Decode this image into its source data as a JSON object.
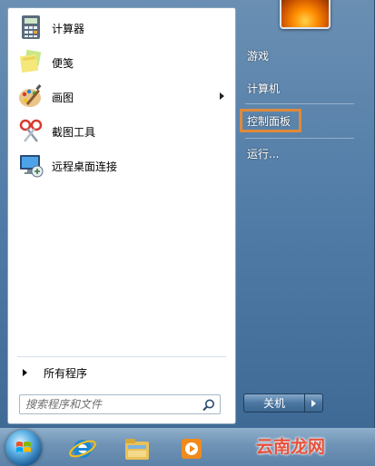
{
  "left_pane": {
    "items": [
      {
        "label": "计算器",
        "icon": "calculator-icon"
      },
      {
        "label": "便笺",
        "icon": "sticky-notes-icon"
      },
      {
        "label": "画图",
        "icon": "paint-icon",
        "has_submenu": true
      },
      {
        "label": "截图工具",
        "icon": "snipping-tool-icon"
      },
      {
        "label": "远程桌面连接",
        "icon": "remote-desktop-icon"
      }
    ],
    "all_programs": "所有程序",
    "search_placeholder": "搜索程序和文件"
  },
  "right_pane": {
    "items": [
      {
        "label": "游戏"
      },
      {
        "label": "计算机"
      },
      {
        "label": "控制面板",
        "highlighted": true,
        "highlight_color": "#e08a3a"
      },
      {
        "label": "运行..."
      }
    ],
    "shutdown_label": "关机"
  },
  "taskbar": {
    "icons": [
      "start-orb-icon",
      "internet-explorer-icon",
      "windows-explorer-icon",
      "media-player-icon"
    ]
  },
  "watermark": "云南龙网"
}
